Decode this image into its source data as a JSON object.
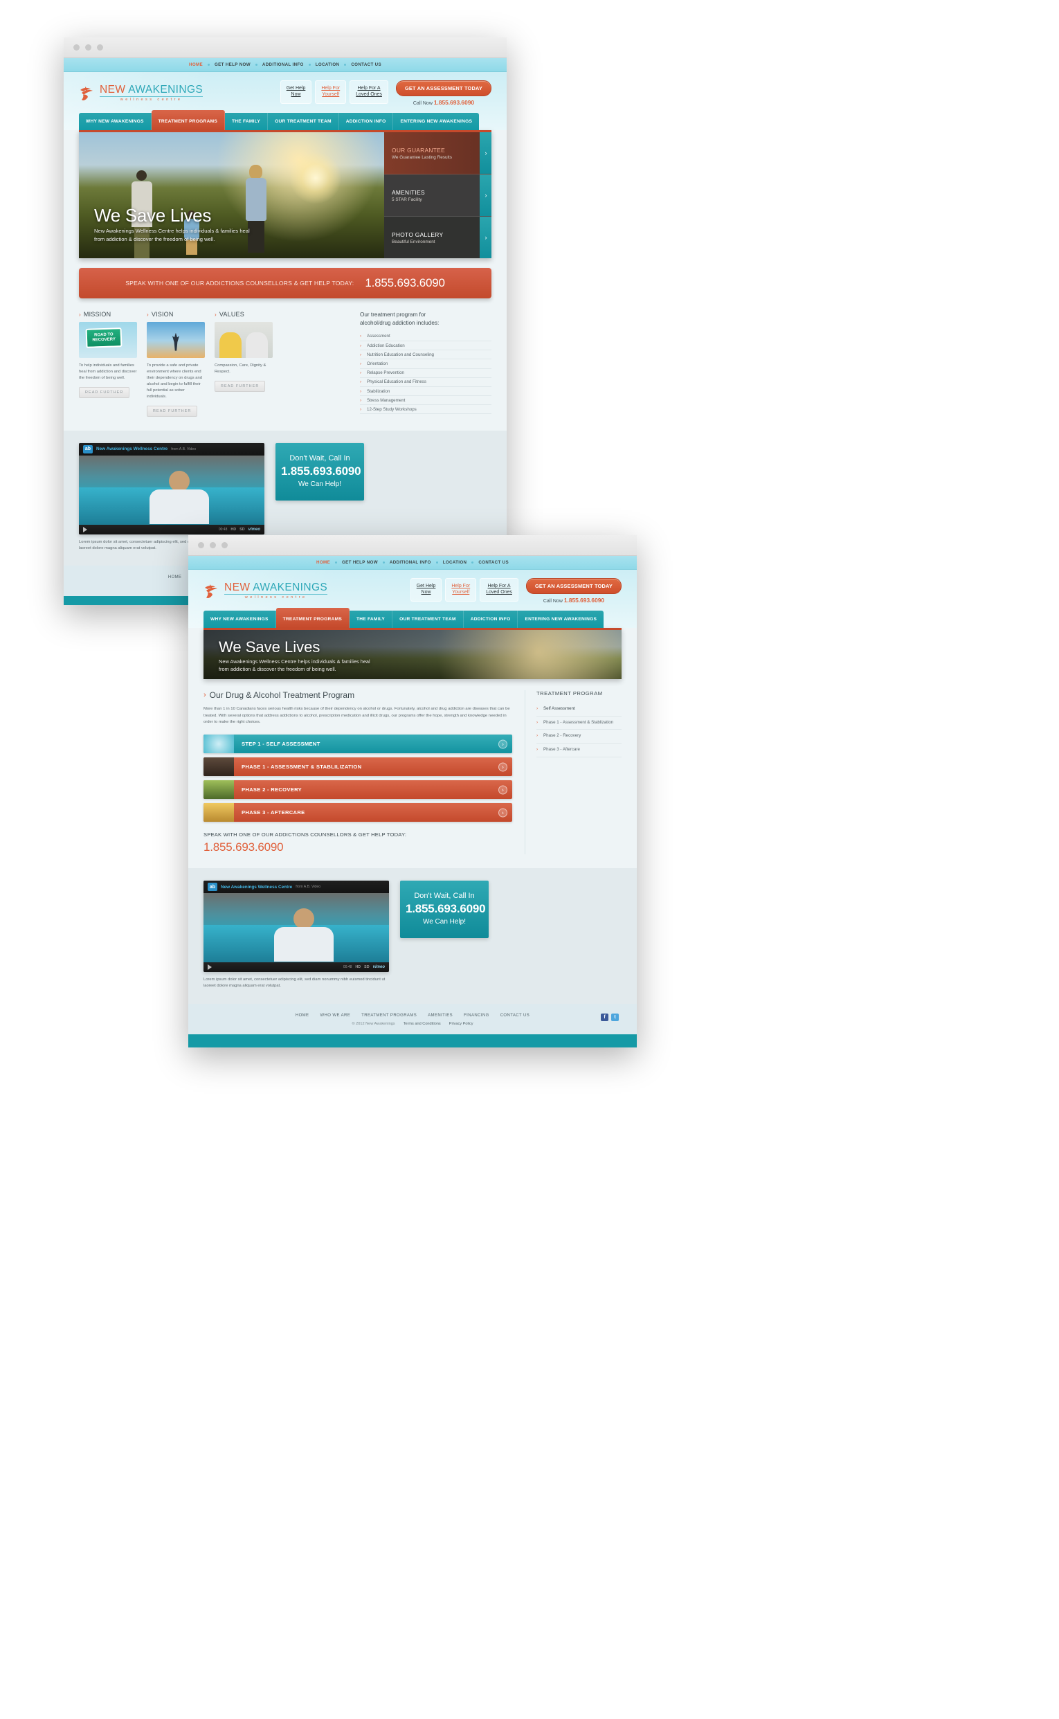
{
  "brand": {
    "logo_word_1": "NEW",
    "logo_word_2": "AWAKENINGS",
    "logo_tagline": "wellness centre",
    "accent_orange": "#e0603b",
    "accent_teal": "#2fa8b8",
    "band_red": "#c54a2c"
  },
  "utility_nav": {
    "items": [
      {
        "label": "HOME",
        "active": true
      },
      {
        "label": "GET HELP NOW",
        "active": false
      },
      {
        "label": "ADDITIONAL INFO",
        "active": false
      },
      {
        "label": "LOCATION",
        "active": false
      },
      {
        "label": "CONTACT US",
        "active": false
      }
    ]
  },
  "header": {
    "pill_1_line1": "Get Help",
    "pill_1_line2": "Now",
    "pill_2_line1": "Help For",
    "pill_2_line2": "Yourself",
    "pill_3_line1": "Help For A",
    "pill_3_line2": "Loved Ones",
    "cta_label": "GET AN ASSESSMENT TODAY",
    "call_now_label": "Call Now",
    "call_now_number": "1.855.693.6090"
  },
  "main_nav": {
    "items": [
      {
        "label": "WHY NEW AWAKENINGS",
        "active": false
      },
      {
        "label": "TREATMENT PROGRAMS",
        "active": true
      },
      {
        "label": "THE FAMILY",
        "active": false
      },
      {
        "label": "OUR TREATMENT TEAM",
        "active": false
      },
      {
        "label": "ADDICTION INFO",
        "active": false
      },
      {
        "label": "ENTERING NEW AWAKENINGS",
        "active": false
      }
    ]
  },
  "home": {
    "hero": {
      "title": "We Save Lives",
      "subtitle_line1": "New Awakenings Wellness Centre helps individuals & families heal",
      "subtitle_line2": "from addiction & discover the freedom of being well.",
      "panels": [
        {
          "title": "OUR GUARANTEE",
          "subtitle": "We Guarantee Lasting Results"
        },
        {
          "title": "AMENITIES",
          "subtitle": "5 STAR Facility"
        },
        {
          "title": "PHOTO GALLERY",
          "subtitle": "Beautiful Environment"
        }
      ]
    },
    "phone_band": {
      "label": "SPEAK WITH ONE OF OUR ADDICTIONS COUNSELLORS & GET HELP TODAY:",
      "number": "1.855.693.6090"
    },
    "columns": [
      {
        "heading": "MISSION",
        "image": "road-to-recovery-sign",
        "sign_line1": "ROAD TO",
        "sign_line2": "RECOVERY",
        "body": "To help individuals and families heal from addiction and discover the freedom of being well.",
        "button": "READ  FURTHER"
      },
      {
        "heading": "VISION",
        "image": "person-arms-raised-sky",
        "body": "To provide a safe and private environment where clients end their dependency on drugs and alcohol and begin to fulfill their full potential as sober individuals.",
        "button": "READ  FURTHER"
      },
      {
        "heading": "VALUES",
        "image": "two-men-smiling",
        "body": "Compassion, Care, Dignity & Respect.",
        "button": "READ  FURTHER"
      }
    ],
    "includes": {
      "heading_line1": "Our treatment program for",
      "heading_line2": "alcohol/drug addiction includes:",
      "items": [
        "Assessment",
        "Addiction Education",
        "Nutrition Education and Counseling",
        "Orientation",
        "Relapse Prevention",
        "Physical Education and Fitness",
        "Stabilization",
        "Stress Management",
        "12-Step Study Workshops"
      ]
    }
  },
  "treatment": {
    "hero": {
      "title": "We Save Lives",
      "subtitle_line1": "New Awakenings Wellness Centre helps individuals & families heal",
      "subtitle_line2": "from addiction & discover the freedom of being well."
    },
    "page_title": "Our Drug & Alcohol Treatment Program",
    "intro": "More than 1 in 10 Canadians faces serious health risks because of their dependency on alcohol or drugs. Fortunately, alcohol and drug addiction are diseases that can be treated. With several options that address addictions to alcohol, prescription medication and illicit drugs, our programs offer the hope, strength and knowledge needed in order to make the right choices.",
    "steps": [
      {
        "label": "STEP 1 - SELF ASSESSMENT",
        "style": "teal"
      },
      {
        "label": "PHASE 1 - ASSESSMENT & STABLILIZATION",
        "style": "red"
      },
      {
        "label": "PHASE 2 - RECOVERY",
        "style": "red"
      },
      {
        "label": "PHASE 3 - AFTERCARE",
        "style": "red"
      }
    ],
    "speak": {
      "label": "SPEAK WITH ONE OF OUR ADDICTIONS COUNSELLORS & GET HELP TODAY:",
      "number": "1.855.693.6090"
    },
    "sidebar": {
      "heading": "TREATMENT PROGRAM",
      "items": [
        {
          "label": "Self Assessment",
          "active": true
        },
        {
          "label": "Phase 1 - Assessment & Stablization",
          "active": false
        },
        {
          "label": "Phase 2 - Recovery",
          "active": false
        },
        {
          "label": "Phase 3 - Aftercare",
          "active": false
        }
      ]
    }
  },
  "video": {
    "badge": "ab",
    "title": "New Awakenings Wellness Centre",
    "subtitle": "from A.B. Video",
    "time": "00:48",
    "quality_hd": "HD",
    "quality_sd": "SD",
    "provider": "vimeo",
    "caption": "Lorem ipsum dolor sit amet, consectetuer adipiscing elit, sed diam nonummy nibh euismod tincidunt ut laoreet dolore magna aliquam erat volutpat."
  },
  "help_box": {
    "line1": "Don't Wait, Call In",
    "line2": "1.855.693.6090",
    "line3": "We Can Help!"
  },
  "footer": {
    "links": [
      "HOME",
      "WHO WE ARE",
      "TREATMENT PROGRAMS",
      "AMENITIES",
      "FINANCING",
      "CONTACT US"
    ],
    "copyright": "© 2012 New Awakenings",
    "terms": "Terms and Conditions",
    "privacy": "Privacy Policy",
    "social": [
      "f",
      "t"
    ]
  }
}
